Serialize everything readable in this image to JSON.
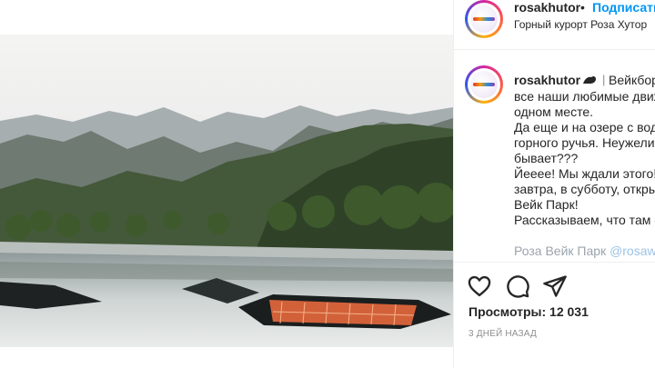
{
  "post": {
    "username": "rosakhutor",
    "follow_label": "Подписаться",
    "dot": "•",
    "location": "Горный курорт Роза Хутор",
    "caption": {
      "first_line": "Вейкбординг, ",
      "lines": [
        "все наши любимые движения в",
        "одном месте.",
        "Да еще и на озере с водой из",
        "горного ручья. Неужели так",
        "бывает???",
        "Йееее! Мы ждали этого! Уже",
        "завтра, в субботу, открывается",
        "Вейк Парк!",
        "Рассказываем, что там есть:"
      ],
      "faded_text": "Роза Вейк Парк ",
      "faded_link": "@rosawakepark"
    },
    "views_label": "Просмотры: 12 031",
    "time_ago": "3 ДНЕЙ НАЗАД"
  },
  "colors": {
    "link": "#0095f6",
    "text": "#262626",
    "muted": "#8e8e8e",
    "border": "#efefef"
  },
  "icons": [
    "heart-icon",
    "comment-icon",
    "share-icon",
    "verified-icon"
  ]
}
